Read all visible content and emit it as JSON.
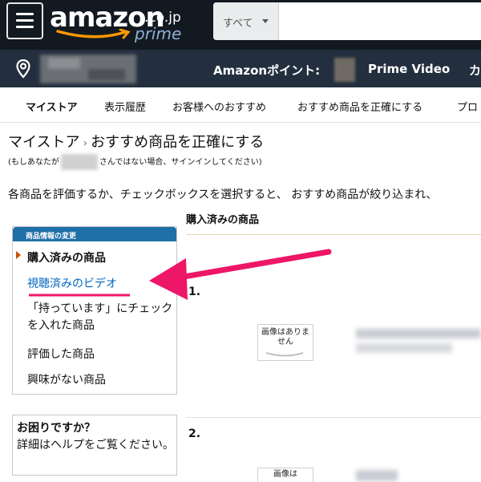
{
  "header": {
    "logo_word": "amazon",
    "logo_tld": ".co.jp",
    "logo_sub": "prime",
    "search_department": "すべて",
    "search_placeholder": "",
    "points_label": "Amazonポイント:",
    "prime_video": "Prime Video",
    "more_cut": "カ"
  },
  "tabs": [
    "マイストア",
    "表示履歴",
    "お客様へのおすすめ",
    "おすすめ商品を正確にする",
    "プロ"
  ],
  "breadcrumb": {
    "home": "マイストア",
    "separator": "›",
    "current": "おすすめ商品を正確にする"
  },
  "signin_note": {
    "before": "(もしあなたが",
    "after": "さんではない場合、サインインしてください)"
  },
  "intro": "各商品を評価するか、チェックボックスを選択すると、 おすすめ商品が絞り込まれ、",
  "sidebar": {
    "header": "商品情報の変更",
    "items": [
      "購入済みの商品",
      "視聴済みのビデオ",
      "「持っています」にチェックを入れた商品",
      "評価した商品",
      "興味がない商品"
    ]
  },
  "help": {
    "title": "お困りですか？",
    "body": "詳細はヘルプをご覧ください。"
  },
  "main": {
    "heading": "購入済みの商品",
    "rows": [
      {
        "number": "1.",
        "image_text": "画像はありません"
      },
      {
        "number": "2.",
        "image_text": "画像は"
      }
    ]
  },
  "colors": {
    "nav_dark": "#131921",
    "nav_sub": "#232f3e",
    "link_blue": "#0066c0",
    "annotation_pink": "#ee1667",
    "sidebar_head": "#1f6fa8"
  }
}
